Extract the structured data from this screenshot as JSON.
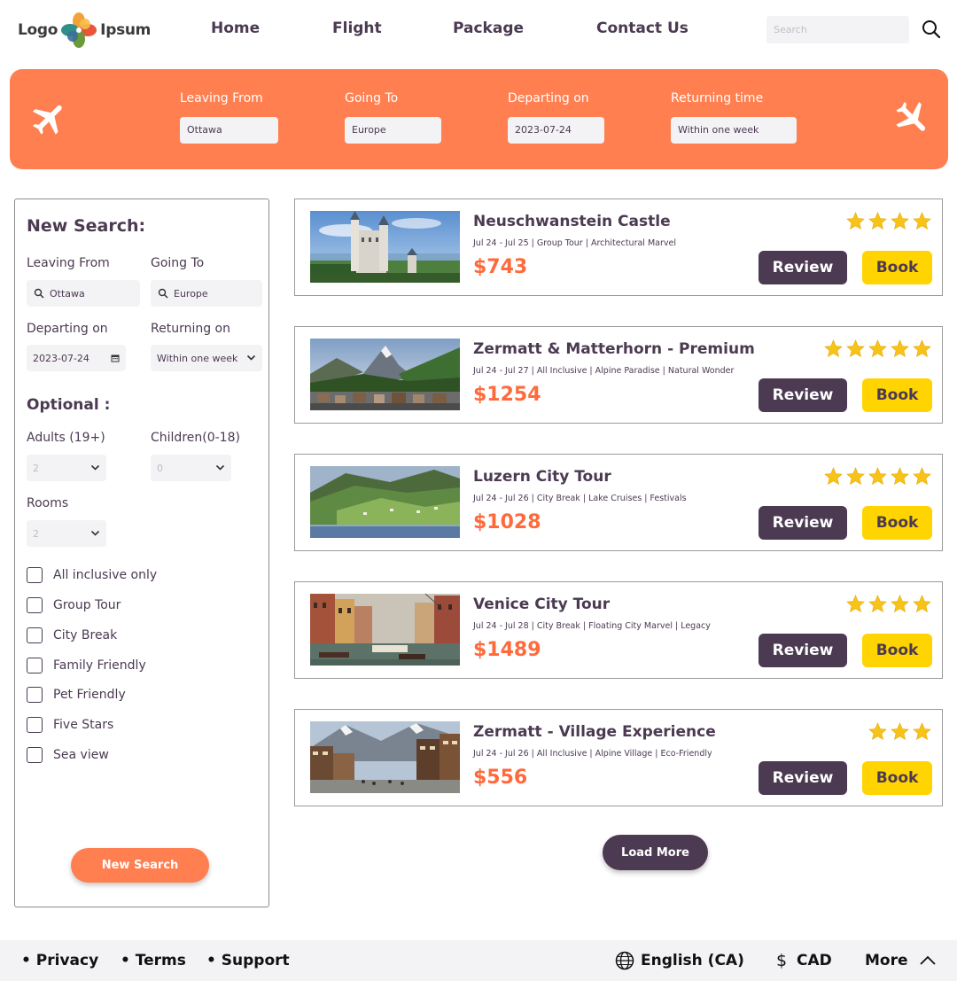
{
  "header": {
    "logo_left": "Logo",
    "logo_right": "Ipsum",
    "nav": [
      "Home",
      "Flight",
      "Package",
      "Contact Us"
    ],
    "search_placeholder": "Search"
  },
  "banner": {
    "fields": [
      {
        "label": "Leaving From",
        "value": "Ottawa"
      },
      {
        "label": "Going To",
        "value": "Europe"
      },
      {
        "label": "Departing on",
        "value": "2023-07-24"
      },
      {
        "label": "Returning time",
        "value": "Within one week"
      }
    ]
  },
  "sidebar": {
    "title": "New Search:",
    "leaving_label": "Leaving From",
    "leaving_value": "Ottawa",
    "going_label": "Going To",
    "going_value": "Europe",
    "departing_label": "Departing on",
    "departing_value": "2023-07-24",
    "returning_label": "Returning on",
    "returning_value": "Within one week",
    "optional_title": "Optional :",
    "adults_label": "Adults (19+)",
    "adults_value": "2",
    "children_label": "Children(0-18)",
    "children_value": "0",
    "rooms_label": "Rooms",
    "rooms_value": "2",
    "checkboxes": [
      "All inclusive only",
      "Group Tour",
      "City Break",
      "Family Friendly",
      "Pet Friendly",
      "Five Stars",
      "Sea view"
    ],
    "button": "New Search"
  },
  "cards": [
    {
      "title": "Neuschwanstein Castle",
      "meta": "Jul 24 - Jul 25 | Group Tour | Architectural Marvel",
      "price": "$743",
      "stars": 4,
      "review": "Review",
      "book": "Book"
    },
    {
      "title": "Zermatt & Matterhorn - Premium",
      "meta": "Jul 24 - Jul 27 | All Inclusive | Alpine Paradise | Natural Wonder",
      "price": "$1254",
      "stars": 5,
      "review": "Review",
      "book": "Book"
    },
    {
      "title": "Luzern City Tour",
      "meta": "Jul 24 - Jul 26 | City Break | Lake Cruises | Festivals",
      "price": "$1028",
      "stars": 5,
      "review": "Review",
      "book": "Book"
    },
    {
      "title": "Venice City Tour",
      "meta": "Jul 24 - Jul 28 | City Break | Floating City Marvel | Legacy",
      "price": "$1489",
      "stars": 4,
      "review": "Review",
      "book": "Book"
    },
    {
      "title": "Zermatt - Village Experience",
      "meta": "Jul 24 - Jul 26 | All Inclusive | Alpine Village | Eco-Friendly",
      "price": "$556",
      "stars": 3,
      "review": "Review",
      "book": "Book"
    }
  ],
  "load_more": "Load More",
  "footer": {
    "links": [
      "Privacy",
      "Terms",
      "Support"
    ],
    "language": "English (CA)",
    "currency": "CAD",
    "more": "More"
  },
  "colors": {
    "accent": "#ff7f50",
    "dark": "#4b3a52",
    "yellow": "#ffd400",
    "price": "#ff6a3d"
  }
}
